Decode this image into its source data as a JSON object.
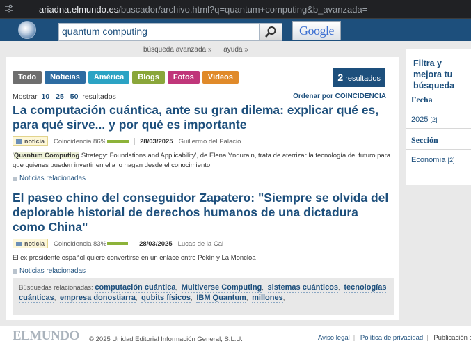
{
  "browser": {
    "url_host": "ariadna.elmundo.es",
    "url_path": "/buscador/archivo.html?q=quantum+computing&b_avanzada="
  },
  "search": {
    "query": "quantum computing",
    "google_label": "Google",
    "advanced_link": "búsqueda avanzada »",
    "help_link": "ayuda »"
  },
  "tabs": [
    {
      "label": "Todo",
      "color": "#6e6e6e"
    },
    {
      "label": "Noticias",
      "color": "#2d6ca2"
    },
    {
      "label": "América",
      "color": "#2ba3c4"
    },
    {
      "label": "Blogs",
      "color": "#8aa63a"
    },
    {
      "label": "Fotos",
      "color": "#c0367a"
    },
    {
      "label": "Vídeos",
      "color": "#e08a2a"
    }
  ],
  "count": {
    "number": "2",
    "label": "resultados"
  },
  "controls": {
    "show_label": "Mostrar",
    "options": [
      "10",
      "25",
      "50"
    ],
    "results_label": "resultados",
    "order_label": "Ordenar por COINCIDENCIA"
  },
  "results": [
    {
      "title": "La computación cuántica, ante su gran dilema: explicar qué es, para qué sirve... y por qué es importante",
      "type": "noticia",
      "coincidence": "Coincidencia 86%",
      "coincidence_value": 0.86,
      "date": "28/03/2025",
      "author": "Guillermo del Palacio",
      "snippet_quote": "'",
      "snippet_highlight": "Quantum Computing",
      "snippet_rest": " Strategy: Foundations and Applicability', de Elena Yndurain, trata de aterrizar la tecnología del futuro para que quienes pueden invertir en ella lo hagan desde el conocimiento",
      "related": "Noticias relacionadas"
    },
    {
      "title": "El paseo chino del conseguidor Zapatero: \"Siempre se olvida del deplorable historial de derechos humanos de una dictadura como China\"",
      "type": "noticia",
      "coincidence": "Coincidencia 83%",
      "coincidence_value": 0.83,
      "date": "28/03/2025",
      "author": "Lucas de la Cal",
      "snippet_quote": "",
      "snippet_highlight": "",
      "snippet_rest": "El ex presidente español quiere convertirse en un enlace entre Pekín y La Moncloa",
      "related": "Noticias relacionadas"
    }
  ],
  "related_searches": {
    "label": "Búsquedas relacionadas:",
    "terms": [
      "computación cuántica",
      "Multiverse Computing",
      "sistemas cuánticos",
      "tecnologías cuánticas",
      "empresa donostiarra",
      "qubits físicos",
      "IBM Quantum",
      "millones"
    ]
  },
  "sidebar": {
    "title": "Filtra y mejora tu búsqueda",
    "sections": [
      {
        "heading": "Fecha",
        "item": "2025",
        "count": "[2]"
      },
      {
        "heading": "Sección",
        "item": "Economía",
        "count": "[2]"
      }
    ]
  },
  "footer": {
    "logo": "ELMUNDO",
    "copyright": "© 2025 Unidad Editorial Información General, S.L.U.",
    "links": [
      "Aviso legal",
      "Política de privacidad",
      "Publicación digital c"
    ]
  }
}
